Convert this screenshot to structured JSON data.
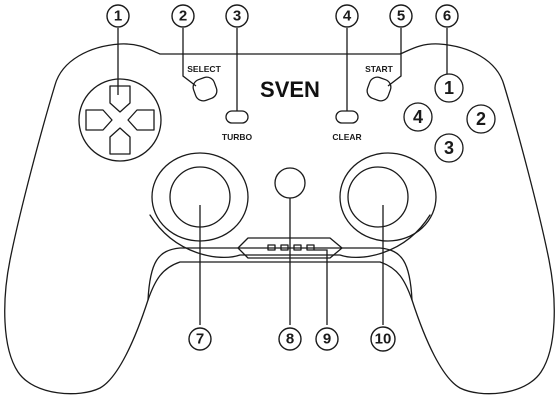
{
  "brand": {
    "logo_text": "SVEN"
  },
  "buttons": {
    "select_label": "SELECT",
    "start_label": "START",
    "turbo_label": "TURBO",
    "clear_label": "CLEAR"
  },
  "face_buttons": [
    "1",
    "2",
    "3",
    "4"
  ],
  "callouts": [
    "1",
    "2",
    "3",
    "4",
    "5",
    "6",
    "7",
    "8",
    "9",
    "10"
  ]
}
